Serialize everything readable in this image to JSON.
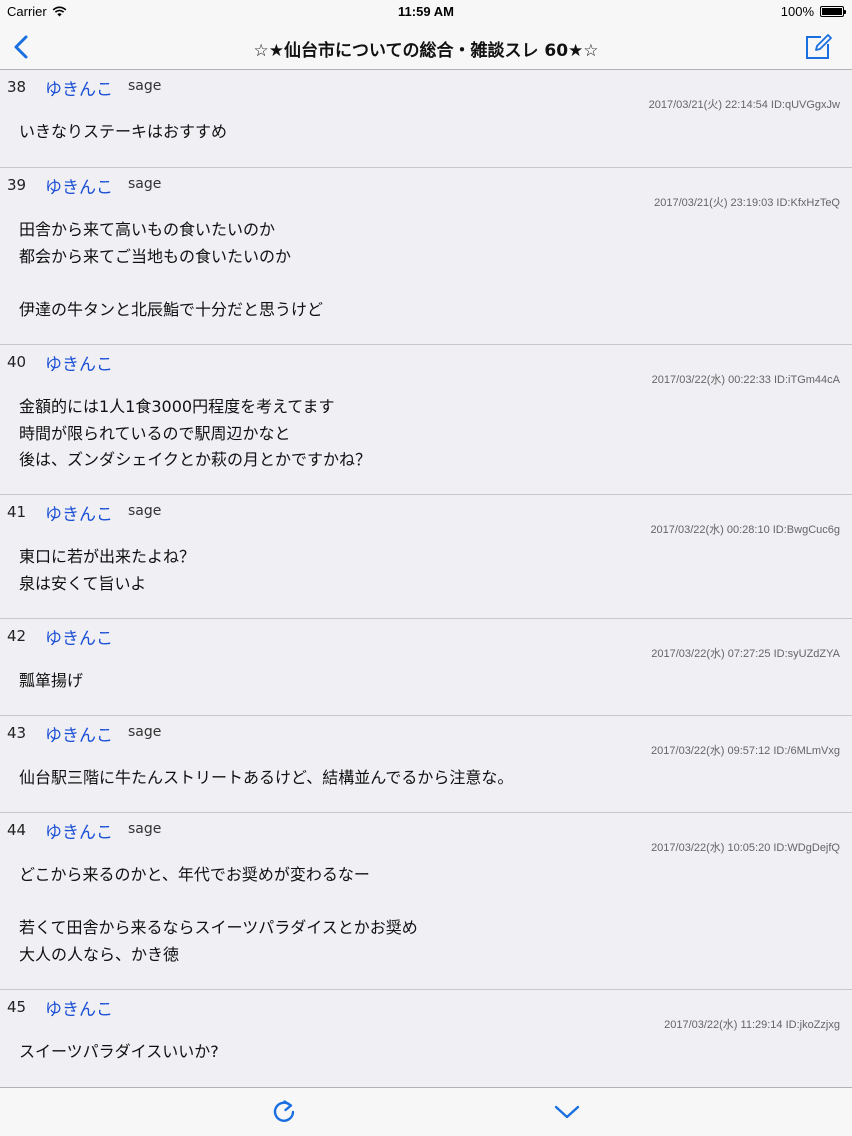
{
  "status_bar": {
    "carrier": "Carrier",
    "time": "11:59 AM",
    "battery": "100%"
  },
  "nav": {
    "title": "☆★仙台市についての総合・雑談スレ 60★☆",
    "back_icon": "chevron-left-icon",
    "compose_icon": "compose-icon"
  },
  "posts": [
    {
      "number": "38",
      "name": "ゆきんこ",
      "mail": "sage",
      "meta": "2017/03/21(火) 22:14:54 ID:qUVGgxJw",
      "lines": [
        "いきなりステーキはおすすめ"
      ]
    },
    {
      "number": "39",
      "name": "ゆきんこ",
      "mail": "sage",
      "meta": "2017/03/21(火) 23:19:03 ID:KfxHzTeQ",
      "lines": [
        "田舎から来て高いもの食いたいのか",
        "都会から来てご当地もの食いたいのか",
        "",
        "伊達の牛タンと北辰鮨で十分だと思うけど"
      ]
    },
    {
      "number": "40",
      "name": "ゆきんこ",
      "mail": "",
      "meta": "2017/03/22(水) 00:22:33 ID:iTGm44cA",
      "lines": [
        "金額的には1人1食3000円程度を考えてます",
        "時間が限られているので駅周辺かなと",
        "後は、ズンダシェイクとか萩の月とかですかね？"
      ]
    },
    {
      "number": "41",
      "name": "ゆきんこ",
      "mail": "sage",
      "meta": "2017/03/22(水) 00:28:10 ID:BwgCuc6g",
      "lines": [
        "東口に若が出来たよね？",
        "泉は安くて旨いよ"
      ]
    },
    {
      "number": "42",
      "name": "ゆきんこ",
      "mail": "",
      "meta": "2017/03/22(水) 07:27:25 ID:syUZdZYA",
      "lines": [
        "瓢箪揚げ"
      ]
    },
    {
      "number": "43",
      "name": "ゆきんこ",
      "mail": "sage",
      "meta": "2017/03/22(水) 09:57:12 ID:/6MLmVxg",
      "lines": [
        "仙台駅三階に牛たんストリートあるけど、結構並んでるから注意な。"
      ]
    },
    {
      "number": "44",
      "name": "ゆきんこ",
      "mail": "sage",
      "meta": "2017/03/22(水) 10:05:20 ID:WDgDejfQ",
      "lines": [
        "どこから来るのかと、年代でお奨めが変わるなー",
        "",
        "若くて田舎から来るならスイーツパラダイスとかお奨め",
        "大人の人なら、かき徳"
      ]
    },
    {
      "number": "45",
      "name": "ゆきんこ",
      "mail": "",
      "meta": "2017/03/22(水) 11:29:14 ID:jkoZzjxg",
      "lines": [
        "スイーツパラダイスいいか?"
      ]
    }
  ],
  "toolbar": {
    "reload_icon": "reload-icon",
    "down_icon": "chevron-down-icon"
  },
  "colors": {
    "accent": "#1a6fe0",
    "name": "#1a4fd6",
    "background": "#efeff4",
    "bar": "#f7f7f7"
  }
}
